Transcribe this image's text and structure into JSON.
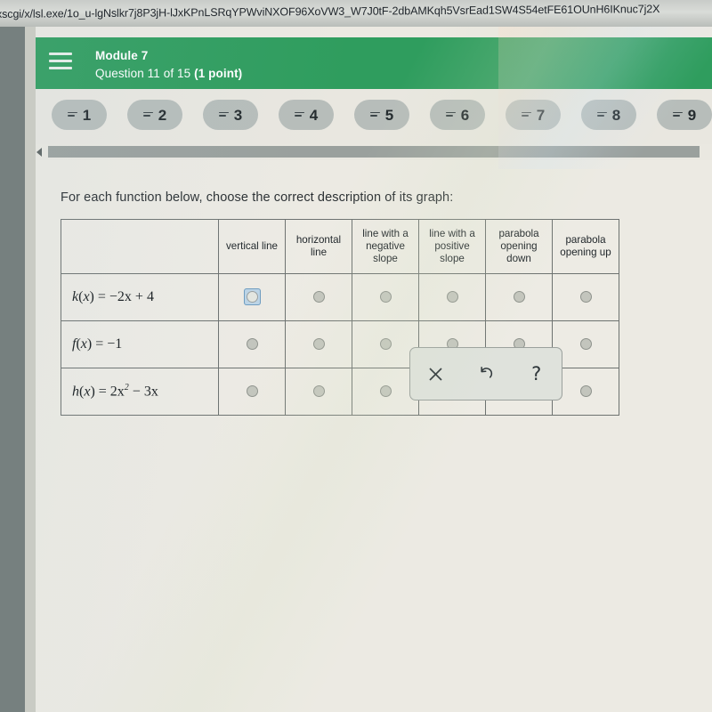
{
  "browser": {
    "url": "xscgi/x/lsl.exe/1o_u-lgNslkr7j8P3jH-lJxKPnLSRqYPWviNXOF96XoVW3_W7J0tF-2dbAMKqh5VsrEad1SW4S54etFE61OUnH6IKnuc7j2X"
  },
  "header": {
    "menu_icon": "hamburger-icon",
    "module_title": "Module 7",
    "question_label": "Question 11 of 15 ",
    "question_points": "(1 point)",
    "background_color": "#2f9d5e"
  },
  "tabs": [
    {
      "number": "1"
    },
    {
      "number": "2"
    },
    {
      "number": "3"
    },
    {
      "number": "4"
    },
    {
      "number": "5"
    },
    {
      "number": "6"
    },
    {
      "number": "7"
    },
    {
      "number": "8"
    },
    {
      "number": "9"
    }
  ],
  "scrollbar": {
    "left_arrow_icon": "caret-left-icon"
  },
  "main": {
    "prompt": "For each function below, choose the correct description of its graph:",
    "table": {
      "corner_header": "",
      "columns": [
        "vertical line",
        "horizontal line",
        "line with a negative slope",
        "line with a positive slope",
        "parabola opening down",
        "parabola opening up"
      ],
      "rows": [
        {
          "function_name": "k",
          "function_var": "x",
          "function_body": " =  −2x + 4",
          "has_exponent": false,
          "selected_index": -1,
          "focused_index": 0
        },
        {
          "function_name": "f",
          "function_var": "x",
          "function_body": " =  −1",
          "has_exponent": false,
          "selected_index": -1,
          "focused_index": -1
        },
        {
          "function_name": "h",
          "function_var": "x",
          "function_body": " =  2x",
          "exponent": "2",
          "function_tail": " − 3x",
          "has_exponent": true,
          "selected_index": -1,
          "focused_index": -1
        }
      ]
    }
  },
  "toolbar": {
    "clear_label": "✕",
    "undo_label": "↺",
    "help_label": "?"
  }
}
